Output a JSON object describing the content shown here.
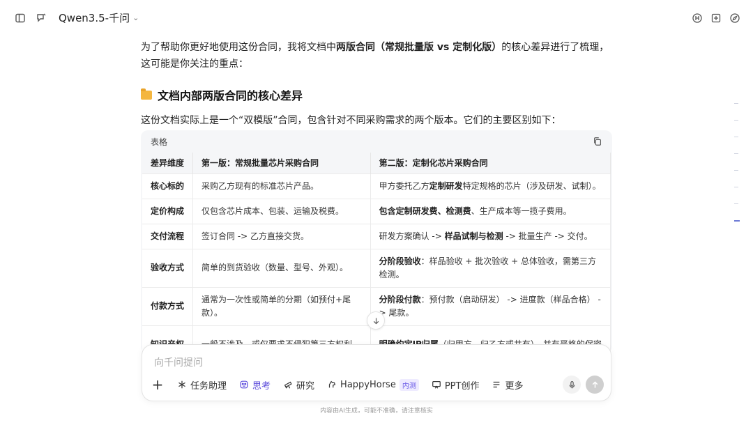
{
  "header": {
    "model_name": "Qwen3.5-千问",
    "icons": [
      "sidebar-toggle-icon",
      "new-chat-icon",
      "translate-icon",
      "screenshot-icon",
      "explore-icon"
    ]
  },
  "content": {
    "intro_1": "为了帮助你更好地使用这份合同，我将文档中",
    "intro_bold": "两版合同（常规批量版 vs 定制化版）",
    "intro_2": "的核心差异进行了梳理，这可能是你关注的重点：",
    "section_title": "文档内部两版合同的核心差异",
    "paragraph": "这份文档实际上是一个“双模版”合同，包含针对不同采购需求的两个版本。它们的主要区别如下："
  },
  "table": {
    "label": "表格",
    "headers": [
      "差异维度",
      "第一版：常规批量芯片采购合同",
      "第二版：定制化芯片采购合同"
    ],
    "rows": [
      {
        "dim": "核心标的",
        "c1": "采购乙方现有的标准芯片产品。",
        "c2_a": "甲方委托乙方",
        "c2_b": "定制研发",
        "c2_c": "特定规格的芯片（涉及研发、试制）。"
      },
      {
        "dim": "定价构成",
        "c1": "仅包含芯片成本、包装、运输及税费。",
        "c2_a": "",
        "c2_b": "包含定制研发费、检测费",
        "c2_c": "、生产成本等一揽子费用。"
      },
      {
        "dim": "交付流程",
        "c1": "签订合同 -> 乙方直接交货。",
        "c2_a": "研发方案确认 -> ",
        "c2_b": "样品试制与检测",
        "c2_c": " -> 批量生产 -> 交付。"
      },
      {
        "dim": "验收方式",
        "c1": "简单的到货验收（数量、型号、外观）。",
        "c2_a": "",
        "c2_b": "分阶段验收",
        "c2_c": "：样品验收 + 批次验收 + 总体验收，需第三方检测。"
      },
      {
        "dim": "付款方式",
        "c1": "通常为一次性或简单的分期（如预付+尾款）。",
        "c2_a": "",
        "c2_b": "分阶段付款",
        "c2_c": "：预付款（启动研发） -> 进度款（样品合格） -> 尾款。"
      },
      {
        "dim": "知识产权",
        "c1": "一般不涉及，或仅要求不侵犯第三方权利。",
        "c2_a": "",
        "c2_b": "明确约定IP归属",
        "c2_c": "（归甲方、归乙方或共有），并有严格的保密"
      }
    ]
  },
  "input": {
    "placeholder": "向千问提问",
    "tools": {
      "task": "任务助理",
      "think": "思考",
      "research": "研究",
      "happyhorse": "HappyHorse",
      "happyhorse_badge": "内测",
      "ppt": "PPT创作",
      "more": "更多"
    }
  },
  "footer": "内容由AI生成，可能不准确，请注意核实"
}
